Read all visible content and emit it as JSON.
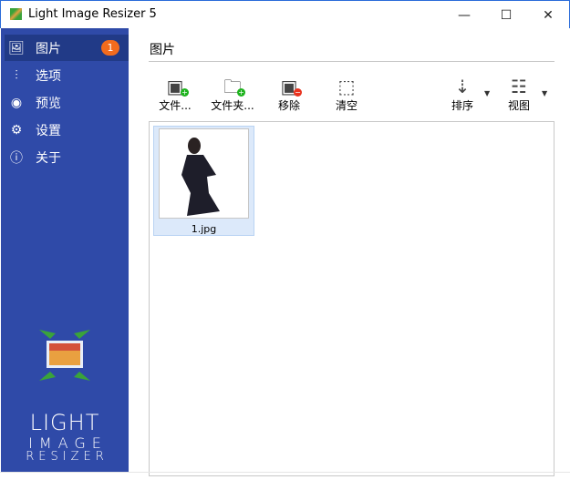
{
  "window": {
    "title": "Light Image Resizer 5",
    "minimize": "—",
    "maximize": "☐",
    "close": "✕"
  },
  "sidebar": {
    "items": [
      {
        "label": "图片",
        "icon": "pictures-icon",
        "glyph": "🖼",
        "badge": "1"
      },
      {
        "label": "选项",
        "icon": "sliders-icon",
        "glyph": "⫶"
      },
      {
        "label": "预览",
        "icon": "eye-icon",
        "glyph": "◉"
      },
      {
        "label": "设置",
        "icon": "gear-icon",
        "glyph": "⚙"
      },
      {
        "label": "关于",
        "icon": "info-icon",
        "glyph": "ⓘ"
      }
    ],
    "logo": {
      "line1": "LIGHT",
      "line2": "IMAGE",
      "line3": "RESIZER"
    }
  },
  "main": {
    "title": "图片",
    "toolbar": {
      "add_files": "文件...",
      "add_folder": "文件夹...",
      "remove": "移除",
      "clear": "清空",
      "sort": "排序",
      "view": "视图"
    },
    "files": [
      {
        "name": "1.jpg"
      }
    ]
  },
  "colors": {
    "sidebar": "#2f4aa8",
    "selected": "#213a87",
    "badge": "#f26b1d",
    "add": "#1db31d",
    "remove": "#e8321e"
  }
}
